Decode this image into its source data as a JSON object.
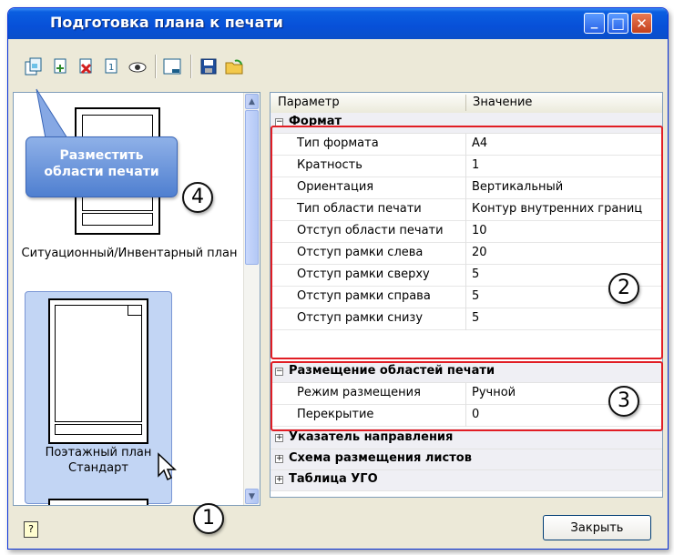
{
  "window": {
    "title": "Подготовка плана к печати",
    "controls": {
      "minimize": "_",
      "maximize": "□",
      "close": "✕"
    }
  },
  "toolbar": {
    "icons": [
      "place-print-areas-icon",
      "add-print-area-icon",
      "delete-print-area-icon",
      "numbering-icon",
      "preview-icon",
      "frame-icon",
      "save-icon",
      "open-icon"
    ]
  },
  "tooltip": {
    "line1": "Разместить",
    "line2": "области печати"
  },
  "templates": [
    {
      "label": "Ситуационный/Инвентарный план",
      "selected": false
    },
    {
      "label": "Поэтажный план Стандарт",
      "selected": true
    }
  ],
  "grid": {
    "headers": {
      "param": "Параметр",
      "value": "Значение"
    },
    "categories": [
      {
        "name": "Формат",
        "expanded": true,
        "rows": [
          {
            "param": "Тип формата",
            "value": "А4"
          },
          {
            "param": "Кратность",
            "value": "1"
          },
          {
            "param": "Ориентация",
            "value": "Вертикальный"
          },
          {
            "param": "Тип области печати",
            "value": "Контур внутренних границ"
          },
          {
            "param": "Отступ области печати",
            "value": "10"
          },
          {
            "param": "Отступ рамки слева",
            "value": "20"
          },
          {
            "param": "Отступ рамки сверху",
            "value": "5"
          },
          {
            "param": "Отступ рамки справа",
            "value": "5"
          },
          {
            "param": "Отступ рамки снизу",
            "value": "5"
          }
        ]
      },
      {
        "name": "Размещение областей печати",
        "expanded": true,
        "rows": [
          {
            "param": "Режим размещения",
            "value": "Ручной"
          },
          {
            "param": "Перекрытие",
            "value": "0"
          }
        ]
      },
      {
        "name": "Указатель направления",
        "expanded": false
      },
      {
        "name": "Схема размещения листов",
        "expanded": false
      },
      {
        "name": "Таблица УГО",
        "expanded": false
      }
    ]
  },
  "callouts": [
    "1",
    "2",
    "3",
    "4"
  ],
  "buttons": {
    "close": "Закрыть",
    "help": "?"
  },
  "colors": {
    "highlight_box": "#e11d24",
    "titlebar": "#0a5ee0",
    "selection": "#c2d5f4"
  }
}
